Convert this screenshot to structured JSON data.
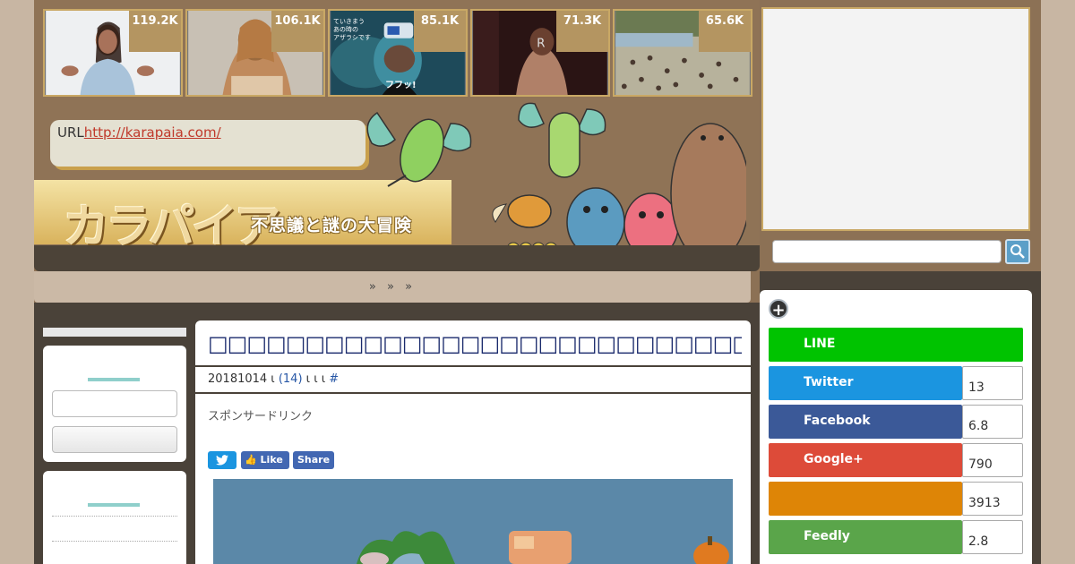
{
  "header": {
    "thumbnails": [
      {
        "count": "119.2K"
      },
      {
        "count": "106.1K"
      },
      {
        "count": "85.1K"
      },
      {
        "count": "71.3K"
      },
      {
        "count": "65.6K"
      }
    ],
    "url_label": "URL",
    "url_link": "http://karapaia.com/",
    "logo_text": "カラパイア",
    "logo_tagline": "不思議と謎の大冒険",
    "thumb3_caption": "フフッ!"
  },
  "breadcrumb": "» » »",
  "article": {
    "title": "□□□□□□□□□□□□□□□□□□□□□□□□□□□□□□□□□□□□□",
    "meta_date": "20181014 ι",
    "meta_comments": "(14)",
    "meta_mid": "ι ι ι",
    "meta_hash": "#",
    "sponsored": "スポンサードリンク",
    "share": {
      "like_label": "Like",
      "share_label": "Share"
    }
  },
  "social": {
    "rows": [
      {
        "label": "LINE",
        "count": "",
        "color": "#00c300"
      },
      {
        "label": "Twitter",
        "count": "13",
        "color": "#1b95e0"
      },
      {
        "label": "Facebook",
        "count": "6.8",
        "color": "#3b5998"
      },
      {
        "label": "Google+",
        "count": "790",
        "color": "#dd4b39"
      },
      {
        "label": "",
        "count": "3913",
        "color": "#de8506"
      },
      {
        "label": "Feedly",
        "count": "2.8",
        "color": "#5aa54a"
      }
    ]
  },
  "colors": {
    "frame": "#8c7155",
    "dark": "#4a4239",
    "link": "#2757a6",
    "title": "#1a2a6c"
  }
}
